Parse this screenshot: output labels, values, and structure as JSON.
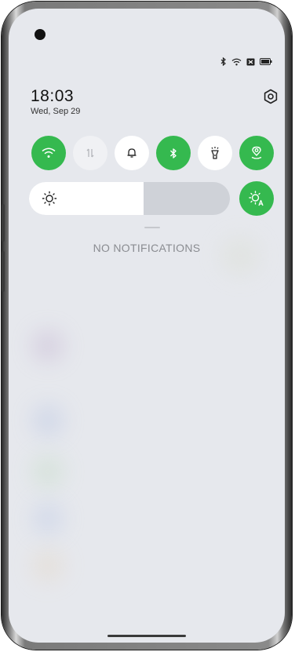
{
  "status_bar": {
    "icons": [
      "bluetooth-icon",
      "wifi-icon",
      "sim-off-icon",
      "battery-icon"
    ]
  },
  "header": {
    "time": "18:03",
    "date": "Wed, Sep 29",
    "settings_icon": "gear-icon"
  },
  "quick_toggles": [
    {
      "name": "wifi",
      "icon": "wifi-icon",
      "state": "on"
    },
    {
      "name": "mobile-data",
      "icon": "data-arrows-icon",
      "state": "off"
    },
    {
      "name": "sound",
      "icon": "bell-icon",
      "state": "off"
    },
    {
      "name": "bluetooth",
      "icon": "bluetooth-icon",
      "state": "on"
    },
    {
      "name": "flashlight",
      "icon": "flashlight-icon",
      "state": "off"
    },
    {
      "name": "location",
      "icon": "location-icon",
      "state": "on"
    }
  ],
  "brightness": {
    "level": 0.57,
    "icon": "sun-icon",
    "auto_icon": "auto-brightness-icon"
  },
  "notifications": {
    "empty_text": "NO NOTIFICATIONS"
  },
  "colors": {
    "accent": "#35b94f",
    "background": "#e6e8ed"
  }
}
